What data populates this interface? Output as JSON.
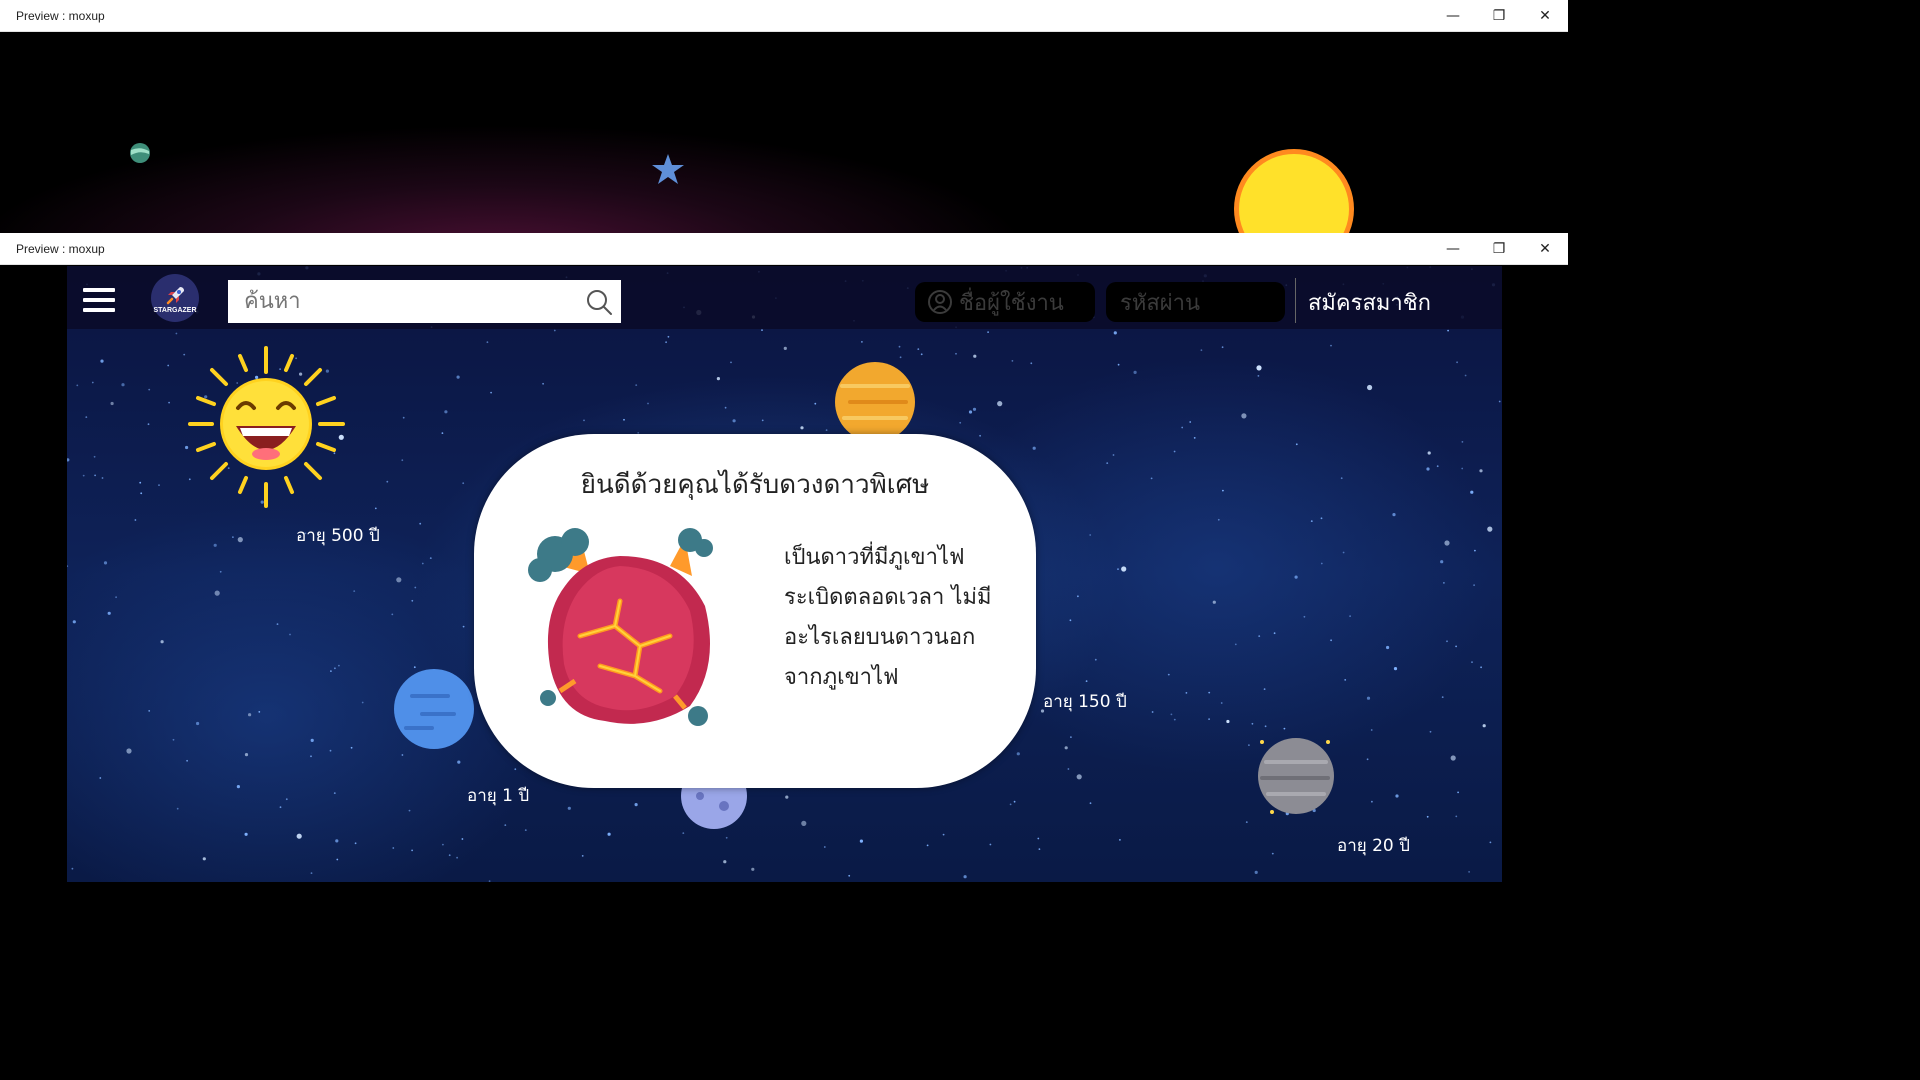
{
  "back_window": {
    "title": "Preview : moxup",
    "controls": {
      "minimize": "—",
      "maximize": "❐",
      "close": "✕"
    }
  },
  "front_window": {
    "title": "Preview : moxup",
    "controls": {
      "minimize": "—",
      "maximize": "❐",
      "close": "✕"
    }
  },
  "navbar": {
    "logo_text": "STARGAZER",
    "search_placeholder": "ค้นหา",
    "username_placeholder": "ชื่อผู้ใช้งาน",
    "password_placeholder": "รหัสผ่าน",
    "signup_label": "สมัครสมาชิก"
  },
  "planets": [
    {
      "name": "sun",
      "age_label": "อายุ 500 ปี"
    },
    {
      "name": "blue-planet",
      "age_label": "อายุ 1 ปี"
    },
    {
      "name": "right-planet",
      "age_label": "อายุ 150 ปี"
    },
    {
      "name": "grey-planet",
      "age_label": "อายุ 20 ปี"
    }
  ],
  "modal": {
    "title": "ยินดีด้วยคุณได้รับดวงดาวพิเศษ",
    "description_lines": [
      "เป็นดาวที่มีภูเขาไฟ",
      "ระเบิดตลอดเวลา ไม่มี",
      "อะไรเลยบนดาวนอก",
      "จากภูเขาไฟ"
    ]
  },
  "colors": {
    "space_dark": "#0b1440",
    "sun_yellow": "#ffe12a",
    "modal_bg": "#ffffff",
    "volcano_planet": "#c2294f"
  }
}
